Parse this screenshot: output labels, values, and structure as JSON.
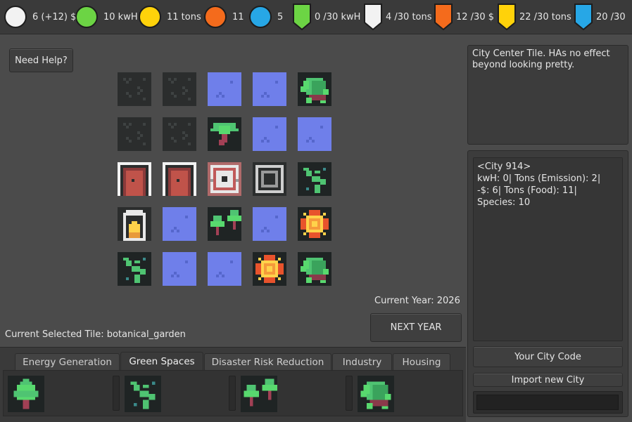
{
  "resources": [
    {
      "icon": "white-circle-icon",
      "color": "#f2f2f2",
      "label": "6 (+12) $"
    },
    {
      "icon": "green-circle-icon",
      "color": "#6cd444",
      "label": "10 kwH"
    },
    {
      "icon": "yellow-circle-icon",
      "color": "#ffd20a",
      "label": "11 tons"
    },
    {
      "icon": "orange-circle-icon",
      "color": "#f46b1c",
      "label": "11"
    },
    {
      "icon": "blue-circle-icon",
      "color": "#27a7e6",
      "label": "5"
    }
  ],
  "limits": [
    {
      "icon": "green-shield-icon",
      "color": "#6cd444",
      "label": "0 /30 kwH"
    },
    {
      "icon": "white-shield-icon",
      "color": "#f2f2f2",
      "label": "4 /30 tons"
    },
    {
      "icon": "orange-shield-icon",
      "color": "#f46b1c",
      "label": "12 /30 $"
    },
    {
      "icon": "yellow-shield-icon",
      "color": "#ffd20a",
      "label": "22 /30 tons"
    },
    {
      "icon": "blue-shield-icon",
      "color": "#27a7e6",
      "label": "20 /30"
    }
  ],
  "help_button": "Need Help?",
  "grid": [
    [
      "asphalt",
      "asphalt",
      "water",
      "water",
      "turtle"
    ],
    [
      "asphalt",
      "asphalt",
      "palm",
      "water",
      "water"
    ],
    [
      "house",
      "house",
      "power-plant",
      "factory",
      "sprout"
    ],
    [
      "lantern",
      "water",
      "trees",
      "water",
      "sunflower"
    ],
    [
      "sprout",
      "water",
      "water",
      "sunflower",
      "turtle"
    ]
  ],
  "current_year": "Current Year: 2026",
  "next_year_button": "NEXT YEAR",
  "selected_tile": "Current Selected Tile: botanical_garden",
  "tile_description": "City Center Tile. HAs no effect beyond looking pretty.",
  "city_stats": [
    "<City 914>",
    "kwH: 0| Tons (Emission): 2|",
    "-$: 6| Tons (Food): 11|",
    "Species: 10"
  ],
  "city_code_button": "Your City Code",
  "import_button": "Import new City",
  "import_input_value": "",
  "tabs": [
    {
      "label": "Energy Generation",
      "active": false
    },
    {
      "label": "Green Spaces",
      "active": true
    },
    {
      "label": "Disaster Risk Reduction",
      "active": false
    },
    {
      "label": "Industry",
      "active": false
    },
    {
      "label": "Housing",
      "active": false
    }
  ],
  "palette": [
    "tree",
    "sprout",
    "trees",
    "turtle"
  ]
}
